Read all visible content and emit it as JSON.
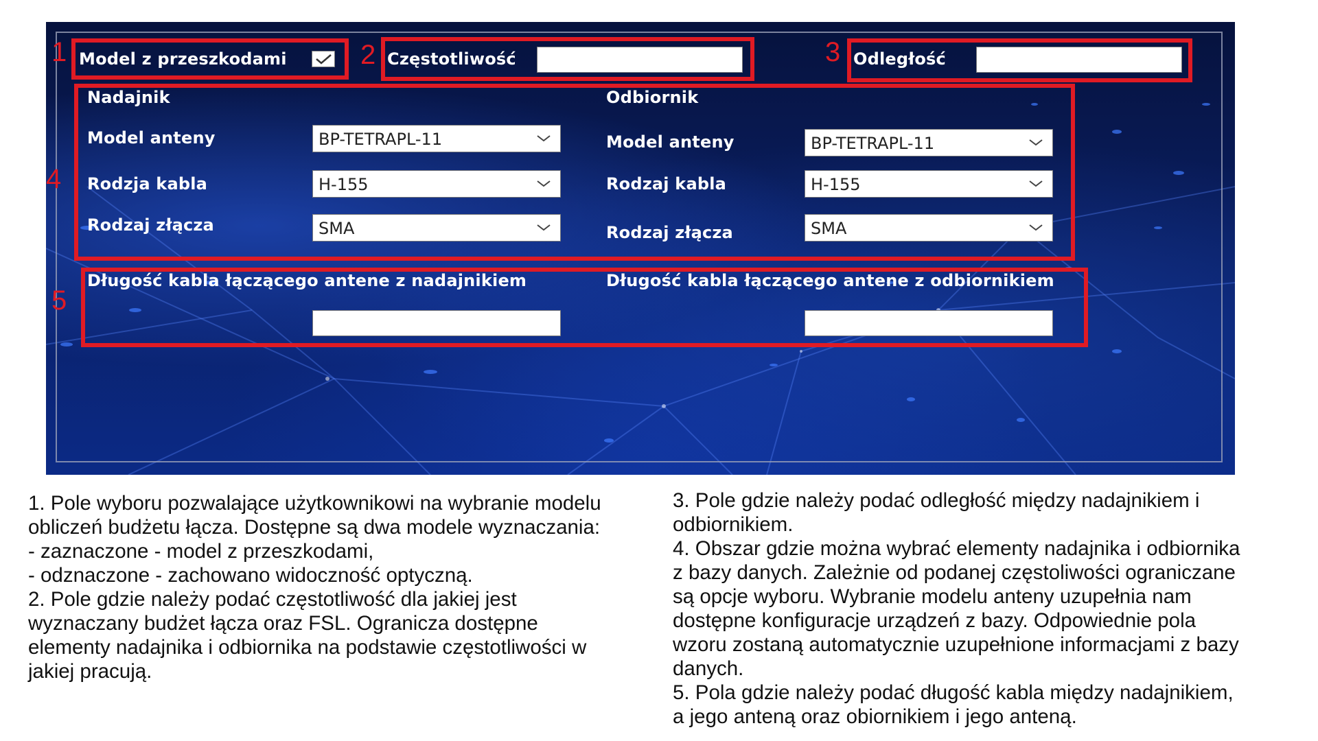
{
  "app": {
    "obstacle_model_label": "Model z przeszkodami",
    "frequency_label": "Częstotliwość",
    "distance_label": "Odległość",
    "frequency_value": "",
    "distance_value": ""
  },
  "transmitter": {
    "title": "Nadajnik",
    "antenna_label": "Model anteny",
    "antenna_value": "BP-TETRAPL-11",
    "cable_label": "Rodzja kabla",
    "cable_value": "H-155",
    "connector_label": "Rodzaj złącza",
    "connector_value": "SMA",
    "cable_length_label": "Długość kabla łączącego antene z nadajnikiem",
    "cable_length_value": ""
  },
  "receiver": {
    "title": "Odbiornik",
    "antenna_label": "Model anteny",
    "antenna_value": "BP-TETRAPL-11",
    "cable_label": "Rodzaj kabla",
    "cable_value": "H-155",
    "connector_label": "Rodzaj złącza",
    "connector_value": "SMA",
    "cable_length_label": "Długość kabla łączącego antene z odbiornikiem",
    "cable_length_value": ""
  },
  "callouts": [
    "1",
    "2",
    "3",
    "4",
    "5"
  ],
  "description_left": [
    "1. Pole wyboru pozwalające użytkownikowi na wybranie modelu",
    "obliczeń budżetu łącza. Dostępne są dwa modele wyznaczania:",
    "- zaznaczone - model z przeszkodami,",
    "- odznaczone - zachowano widoczność optyczną.",
    "2. Pole gdzie należy podać częstotliwość dla jakiej jest",
    "wyznaczany budżet łącza oraz FSL. Ogranicza dostępne",
    "elementy nadajnika i odbiornika na podstawie częstotliwości w",
    "jakiej pracują."
  ],
  "description_right": [
    "3. Pole gdzie należy podać odległość między nadajnikiem i",
    "odbiornikiem.",
    "4. Obszar gdzie można wybrać elementy nadajnika i odbiornika",
    "z bazy danych. Zależnie od podanej częstoliwości ograniczane",
    "są opcje wyboru. Wybranie modelu anteny uzupełnia nam",
    "dostępne konfiguracje urządzeń z bazy. Odpowiednie pola",
    "wzoru zostaną automatycznie uzupełnione informacjami z bazy",
    "danych.",
    "5. Pola gdzie należy podać długość kabla między nadajnikiem,",
    "a jego anteną oraz obiornikiem i jego anteną."
  ],
  "colors": {
    "callout": "#e01b24",
    "label_text": "#ffffff",
    "background_dark": "#06123d",
    "background_light": "#0b2a86"
  },
  "icons": [
    "checkmark-icon",
    "chevron-down-icon"
  ],
  "obstacle_model_checked": true
}
